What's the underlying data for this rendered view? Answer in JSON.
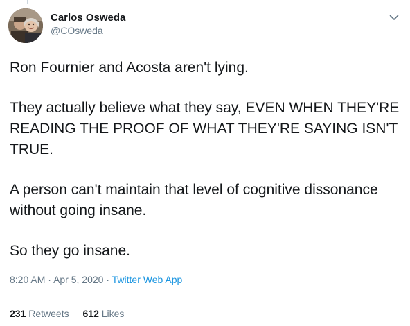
{
  "user": {
    "display_name": "Carlos Osweda",
    "handle": "@COsweda"
  },
  "tweet": {
    "paragraphs": [
      "Ron Fournier and Acosta aren't lying.",
      "They actually believe what they say, EVEN WHEN THEY'RE READING THE PROOF OF WHAT THEY'RE SAYING ISN'T TRUE.",
      "A person can't maintain that level of cognitive dissonance without going insane.",
      "So they go insane."
    ],
    "time": "8:20 AM",
    "date": "Apr 5, 2020",
    "separator": "·",
    "source": "Twitter Web App"
  },
  "stats": {
    "retweets_count": "231",
    "retweets_label": "Retweets",
    "likes_count": "612",
    "likes_label": "Likes"
  },
  "icons": {
    "menu": "chevron-down-icon"
  },
  "colors": {
    "text": "#14171a",
    "secondary": "#657786",
    "link": "#1b95e0",
    "divider": "#e6ecf0"
  }
}
